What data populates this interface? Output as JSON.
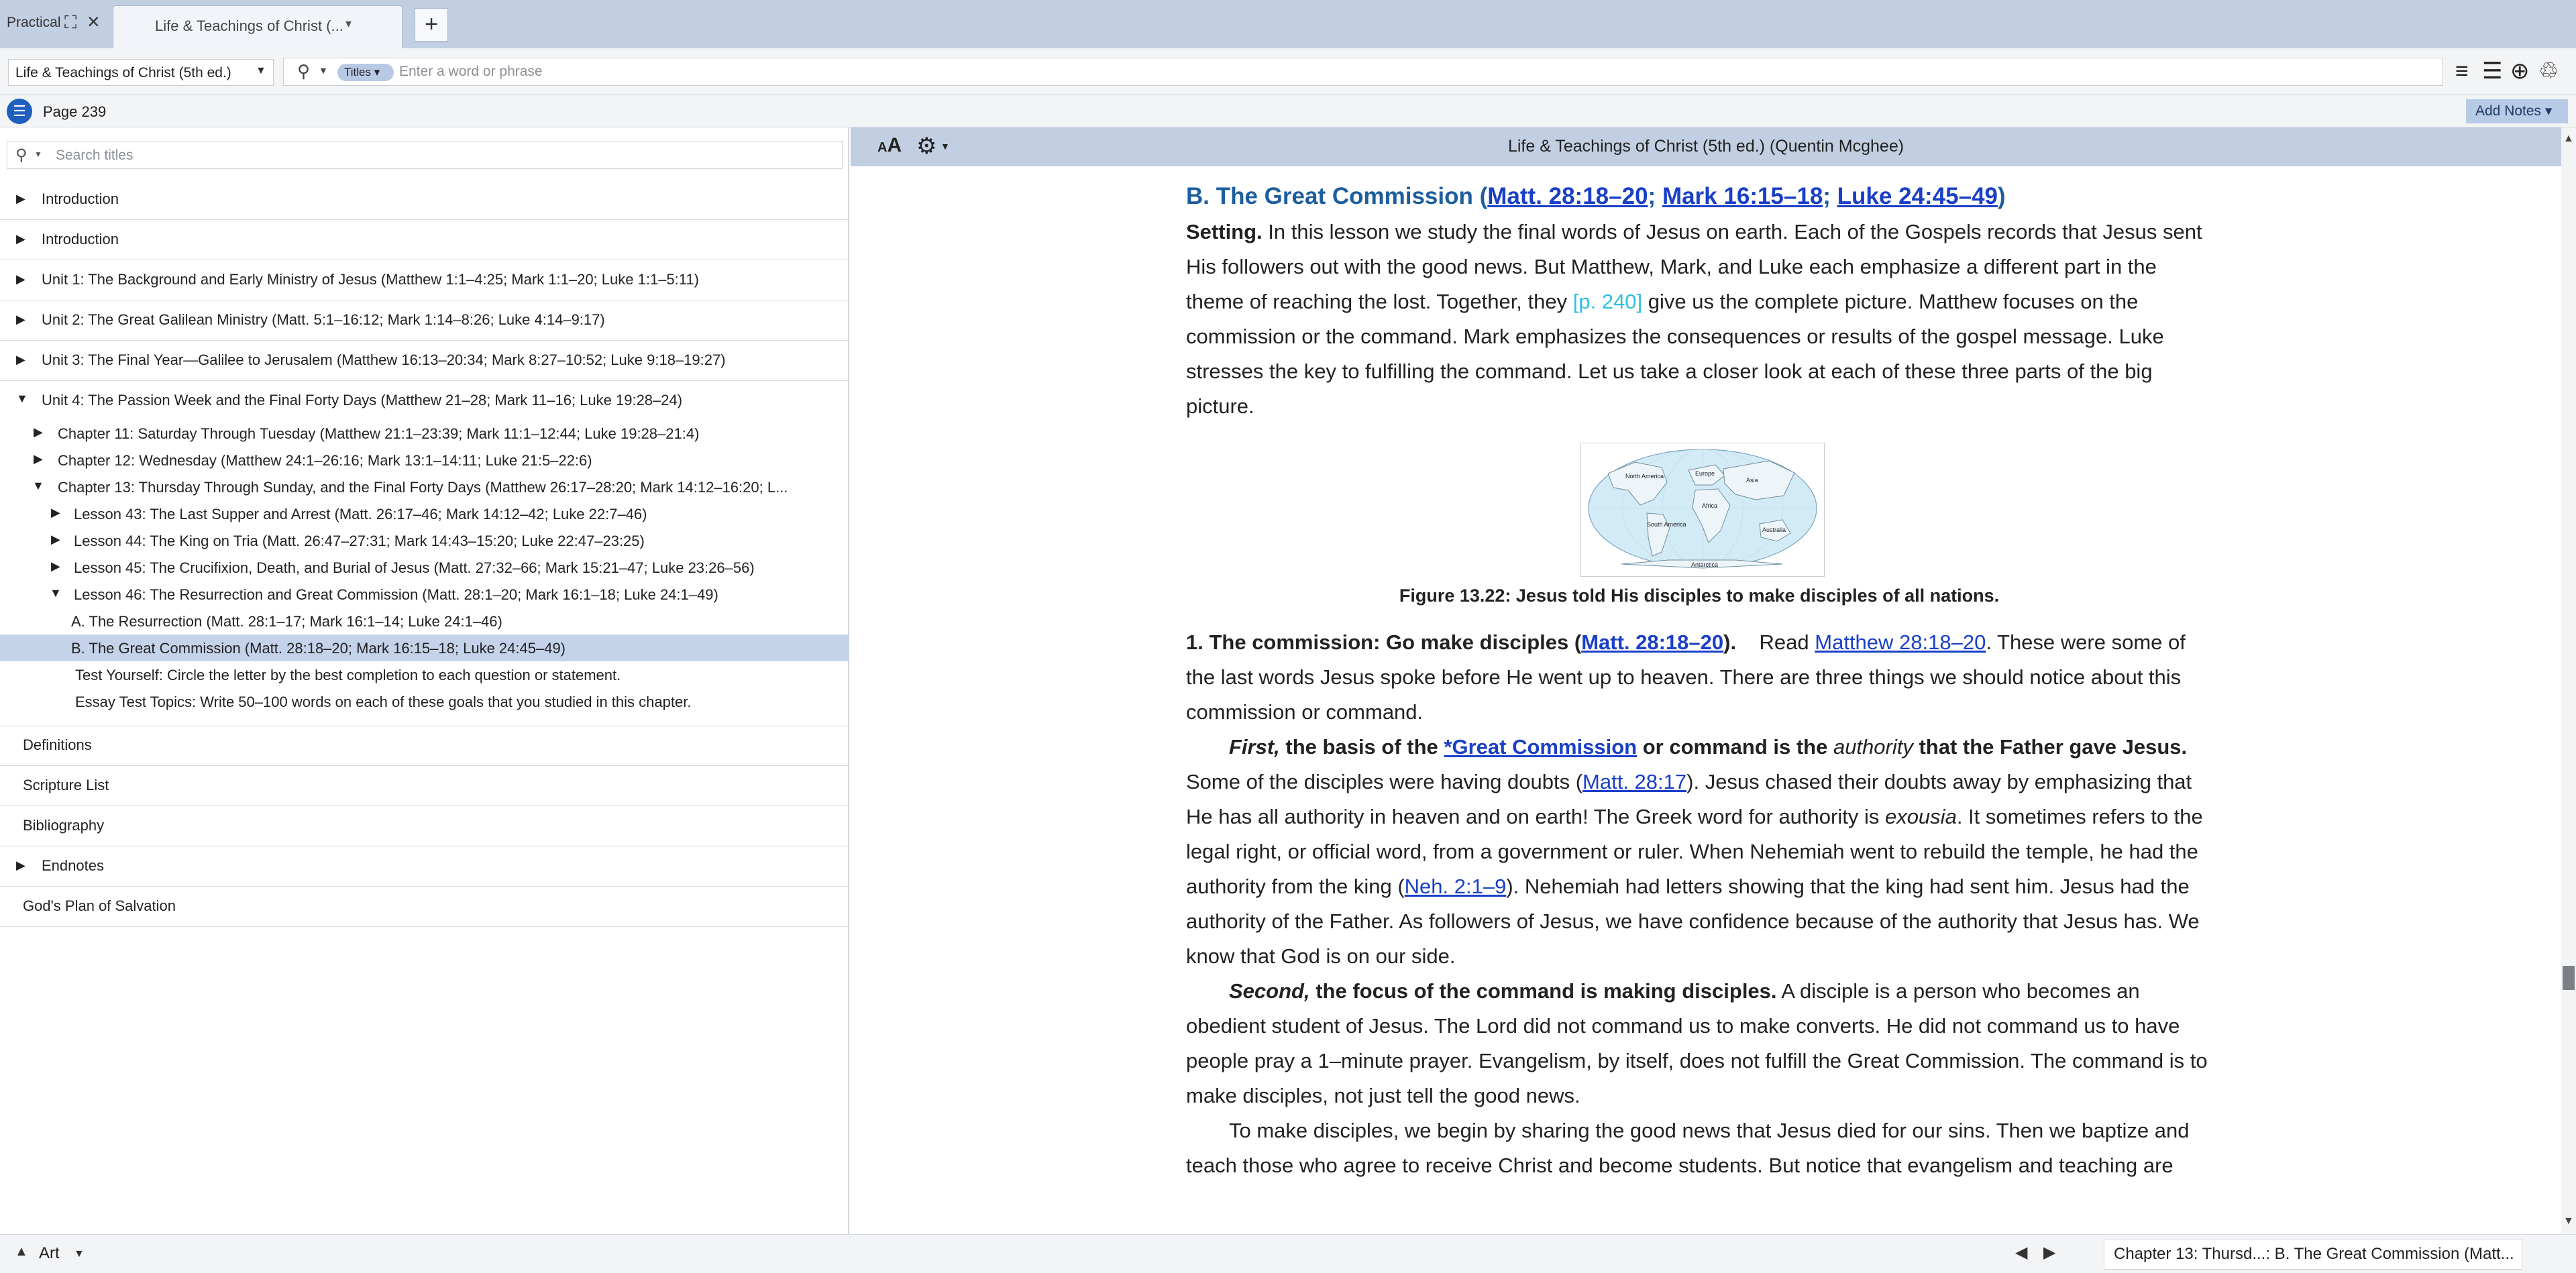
{
  "tabbar": {
    "workspace": "Practical",
    "doc_tab": "Life & Teachings of Christ (...",
    "new_tab": "+"
  },
  "toolbar": {
    "resource": "Life & Teachings of Christ (5th ed.)",
    "search_scope": "Titles",
    "search_placeholder": "Enter a word or phrase"
  },
  "pagebar": {
    "page": "Page 239",
    "add_notes": "Add Notes"
  },
  "toc": {
    "search_placeholder": "Search titles",
    "top_rows": [
      "Introduction",
      "Introduction",
      "Unit 1: The Background and Early Ministry of Jesus (Matthew 1:1–4:25; Mark 1:1–20; Luke 1:1–5:11)",
      "Unit 2: The Great Galilean Ministry (Matt. 5:1–16:12; Mark 1:14–8:26; Luke 4:14–9:17)",
      "Unit 3: The Final Year—Galilee to Jerusalem (Matthew 16:13–20:34; Mark 8:27–10:52; Luke 9:18–19:27)",
      "Unit 4: The Passion Week and the Final Forty Days (Matthew 21–28; Mark 11–16; Luke 19:28–24)"
    ],
    "chapters": [
      "Chapter 11: Saturday Through Tuesday (Matthew 21:1–23:39; Mark 11:1–12:44; Luke 19:28–21:4)",
      "Chapter 12: Wednesday (Matthew 24:1–26:16; Mark 13:1–14:11; Luke 21:5–22:6)",
      "Chapter 13: Thursday Through Sunday, and the Final Forty Days (Matthew 26:17–28:20; Mark 14:12–16:20; L..."
    ],
    "lessons": [
      "Lesson 43: The Last Supper and Arrest (Matt. 26:17–46; Mark 14:12–42; Luke 22:7–46)",
      "Lesson 44: The King on Tria (Matt. 26:47–27:31; Mark 14:43–15:20; Luke 22:47–23:25)",
      "Lesson 45: The Crucifixion, Death, and Burial of Jesus (Matt. 27:32–66; Mark 15:21–47; Luke 23:26–56)",
      "Lesson 46: The Resurrection and Great Commission (Matt. 28:1–20; Mark 16:1–18; Luke 24:1–49)"
    ],
    "sections": [
      "A. The Resurrection (Matt. 28:1–17; Mark 16:1–14; Luke 24:1–46)",
      "B. The Great Commission (Matt. 28:18–20; Mark 16:15–18; Luke 24:45–49)",
      "Test Yourself: Circle the letter by the best completion to each question or statement.",
      "Essay Test Topics: Write 50–100 words on each of these goals that you studied in this chapter."
    ],
    "bottom_rows": [
      "Definitions",
      "Scripture List",
      "Bibliography",
      "Endnotes",
      "God's Plan of Salvation"
    ]
  },
  "reader": {
    "title": "Life & Teachings of Christ (5th ed.) (Quentin Mcghee)",
    "heading_prefix": "B.   The Great Commission (",
    "refs": {
      "matt_28_18_20": "Matt. 28:18–20",
      "mark_16_15_18": "Mark 16:15–18",
      "luke_24_45_49": "Luke 24:45–49",
      "matthew_28_18_20": "Matthew 28:18–20",
      "matt_28_17": "Matt. 28:17",
      "neh_2_1_9": "Neh. 2:1–9",
      "great_commission": "*Great Commission"
    },
    "setting_label": "Setting.",
    "setting_a": " In this lesson we study the final words of Jesus on earth. Each of the Gospels records that Jesus sent His followers out with the good news. But Matthew, Mark, and Luke each emphasize a different part in the theme of reaching the lost. Together, they ",
    "page_marker": "[p. 240]",
    "setting_b": " give us the complete picture. Matthew focuses on the commission or the command. Mark emphasizes the consequences or results of the gospel message. Luke stresses the key to fulfilling the command. Let us take a closer look at each of these three parts of the big picture.",
    "figure_caption": "Figure 13.22: Jesus told His disciples to make disciples of all nations.",
    "map_labels": {
      "north_america": "North America",
      "europe": "Europe",
      "asia": "Asia",
      "africa": "Africa",
      "south_america": "South America",
      "australia": "Australia",
      "antarctica": "Antarctica"
    },
    "p1_heading": "1.   The commission: Go make disciples (",
    "p1_read": "    Read ",
    "p1_text": ". These were some of the last words Jesus spoke before He went up to heaven. There are three things we should notice about this commission or command.",
    "p2_first": "First,",
    "p2_bold_a": " the basis of the ",
    "p2_bold_b": " or command is the ",
    "p2_authority": "authority",
    "p2_bold_c": " that the Father gave Jesus.",
    "p2_text_a": " Some of the disciples were having doubts (",
    "p2_text_b": "). Jesus chased their doubts away by emphasizing that He has all authority in heaven and on earth! The Greek word for authority is ",
    "p2_exousia": "exousia",
    "p2_text_c": ". It sometimes refers to the legal right, or official word, from a government or ruler. When Nehemiah went to rebuild the temple, he had the authority from the king (",
    "p2_text_d": "). Nehemiah had letters showing that the king had sent him. Jesus had the authority of the Father. As followers of Jesus, we have confidence because of the authority that Jesus has. We know that God is on our side.",
    "p3_second": "Second,",
    "p3_bold": " the focus of the command is making disciples.",
    "p3_text": " A disciple is a person who becomes an obedient student of Jesus. The Lord did not command us to make converts. He did not command us to have people pray a 1–minute prayer. Evangelism, by itself, does not fulfill the Great Commission. The command is to make disciples, not just tell the good news.",
    "p4_text": "To make disciples, we begin by sharing the good news that Jesus died for our sins. Then we baptize and teach those who agree to receive Christ and become students. But notice that evangelism and teaching are"
  },
  "bottombar": {
    "layout": "Art",
    "breadcrumb": "Chapter 13: Thursd...: B. The Great Commission (Matt..."
  }
}
